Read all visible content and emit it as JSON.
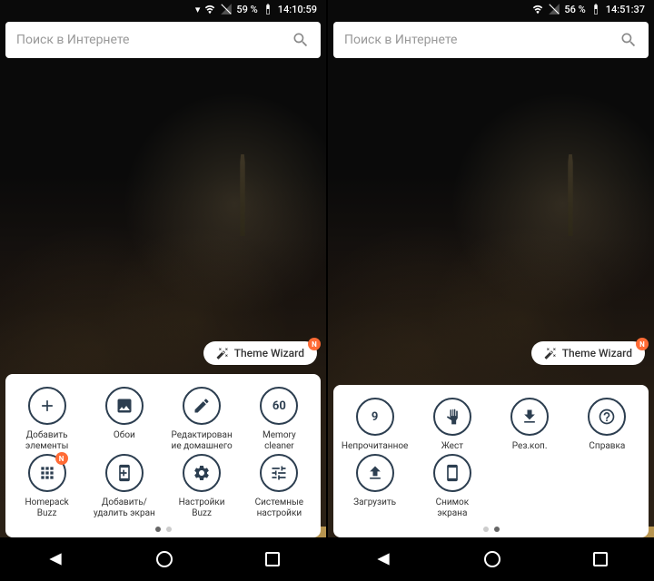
{
  "left": {
    "status": {
      "battery": "59 %",
      "time": "14:10:59"
    },
    "search": {
      "placeholder": "Поиск в Интернете"
    },
    "theme_wizard": "Theme Wizard",
    "items": [
      {
        "label": "Добавить\nэлементы",
        "icon": "plus"
      },
      {
        "label": "Обои",
        "icon": "image"
      },
      {
        "label": "Редактирован\nие домашнего",
        "icon": "pencil"
      },
      {
        "label": "Memory\ncleaner",
        "icon": "num60"
      },
      {
        "label": "Homepack\nBuzz",
        "icon": "homepack",
        "badge": "N"
      },
      {
        "label": "Добавить/\nудалить экран",
        "icon": "screen-plus"
      },
      {
        "label": "Настройки\nBuzz",
        "icon": "gear"
      },
      {
        "label": "Системные\nнастройки",
        "icon": "sliders"
      }
    ],
    "active_dot": 0
  },
  "right": {
    "status": {
      "battery": "56 %",
      "time": "14:51:37"
    },
    "search": {
      "placeholder": "Поиск в Интернете"
    },
    "theme_wizard": "Theme Wizard",
    "items": [
      {
        "label": "Непрочитанное",
        "icon": "num9"
      },
      {
        "label": "Жест",
        "icon": "hand"
      },
      {
        "label": "Рез.коп.",
        "icon": "download"
      },
      {
        "label": "Справка",
        "icon": "question"
      },
      {
        "label": "Загрузить",
        "icon": "upload"
      },
      {
        "label": "Снимок\nэкрана",
        "icon": "phone"
      },
      {
        "label": "",
        "icon": ""
      },
      {
        "label": "",
        "icon": ""
      }
    ],
    "active_dot": 1
  }
}
